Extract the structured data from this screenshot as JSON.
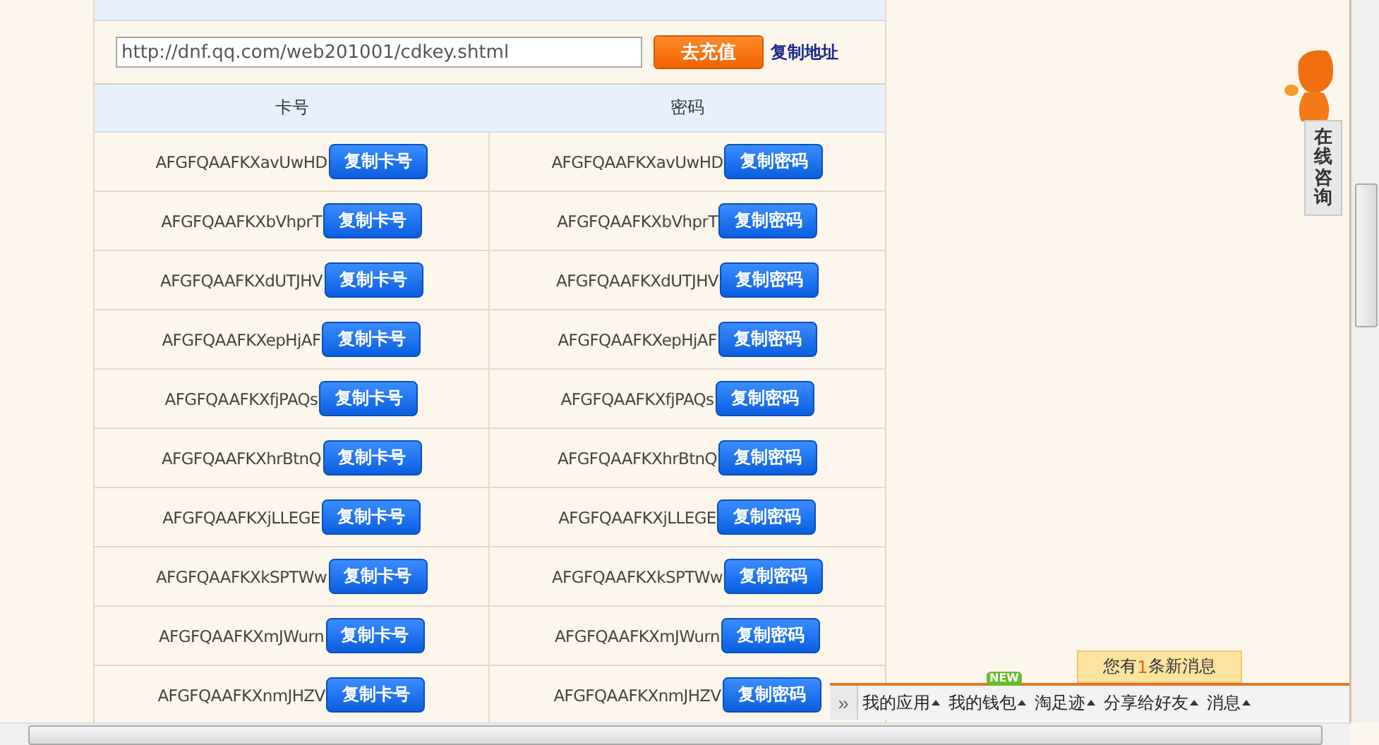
{
  "recharge": {
    "url": "http://dnf.qq.com/web201001/cdkey.shtml",
    "charge_button": "去充值",
    "copy_link": "复制地址"
  },
  "table": {
    "columns": [
      "卡号",
      "密码"
    ],
    "rows": [
      {
        "card": "AFGFQAAFKXavUwHD",
        "card_button": "复制卡号",
        "password": "AFGFQAAFKXavUwHD",
        "password_button": "复制密码"
      },
      {
        "card": "AFGFQAAFKXbVhprT",
        "card_button": "复制卡号",
        "password": "AFGFQAAFKXbVhprT",
        "password_button": "复制密码"
      },
      {
        "card": "AFGFQAAFKXdUTJHV",
        "card_button": "复制卡号",
        "password": "AFGFQAAFKXdUTJHV",
        "password_button": "复制密码"
      },
      {
        "card": "AFGFQAAFKXepHjAF",
        "card_button": "复制卡号",
        "password": "AFGFQAAFKXepHjAF",
        "password_button": "复制密码"
      },
      {
        "card": "AFGFQAAFKXfjPAQs",
        "card_button": "复制卡号",
        "password": "AFGFQAAFKXfjPAQs",
        "password_button": "复制密码"
      },
      {
        "card": "AFGFQAAFKXhrBtnQ",
        "card_button": "复制卡号",
        "password": "AFGFQAAFKXhrBtnQ",
        "password_button": "复制密码"
      },
      {
        "card": "AFGFQAAFKXjLLEGE",
        "card_button": "复制卡号",
        "password": "AFGFQAAFKXjLLEGE",
        "password_button": "复制密码"
      },
      {
        "card": "AFGFQAAFKXkSPTWw",
        "card_button": "复制卡号",
        "password": "AFGFQAAFKXkSPTWw",
        "password_button": "复制密码"
      },
      {
        "card": "AFGFQAAFKXmJWurn",
        "card_button": "复制卡号",
        "password": "AFGFQAAFKXmJWurn",
        "password_button": "复制密码"
      },
      {
        "card": "AFGFQAAFKXnmJHZV",
        "card_button": "复制卡号",
        "password": "AFGFQAAFKXnmJHZV",
        "password_button": "复制密码"
      }
    ]
  },
  "consult_tab": "在线咨询",
  "notification": {
    "prefix": "您有",
    "count": "1",
    "suffix": "条新消息"
  },
  "toolbar": {
    "expand": "»",
    "items": [
      {
        "label": "我的应用"
      },
      {
        "label": "我的钱包",
        "badge": "NEW"
      },
      {
        "label": "淘足迹"
      },
      {
        "label": "分享给好友"
      },
      {
        "label": "消息"
      }
    ]
  }
}
